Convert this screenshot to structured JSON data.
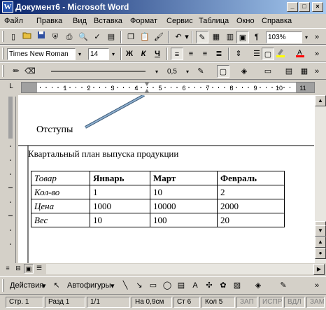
{
  "window": {
    "title": "Документ6 - Microsoft Word",
    "app_icon_letter": "W",
    "minimize": "_",
    "maximize": "□",
    "close": "×"
  },
  "menu": [
    "Файл",
    "Правка",
    "Вид",
    "Вставка",
    "Формат",
    "Сервис",
    "Таблица",
    "Окно",
    "Справка"
  ],
  "standard_toolbar": {
    "zoom": "103%"
  },
  "formatting_toolbar": {
    "font_name": "Times New Roman",
    "font_size": "14",
    "bold": "Ж",
    "italic": "К",
    "underline": "Ч"
  },
  "drawing_line_toolbar": {
    "line_weight": "0,5"
  },
  "ruler": {
    "numbers": [
      "1",
      "2",
      "3",
      "4",
      "5",
      "6",
      "7",
      "8",
      "9",
      "10",
      "11"
    ]
  },
  "document": {
    "callout": "Отступы",
    "heading": "Квартальный план выпуска продукции",
    "table": [
      [
        "Товар",
        "Январь",
        "Март",
        "Февраль"
      ],
      [
        "Кол-во",
        "1",
        "10",
        "2"
      ],
      [
        "Цена",
        "1000",
        "10000",
        "2000"
      ],
      [
        "Вес",
        "10",
        "100",
        "20"
      ]
    ]
  },
  "drawing_toolbar": {
    "actions": "Действия",
    "autoshapes": "Автофигуры"
  },
  "status": {
    "page": "Стр. 1",
    "section": "Разд 1",
    "pages": "1/1",
    "position": "На 0,9см",
    "line": "Ст 6",
    "column": "Кол 5",
    "rec": "ЗАП",
    "trk": "ИСПР",
    "ext": "ВДЛ",
    "ovr": "ЗАМ"
  }
}
